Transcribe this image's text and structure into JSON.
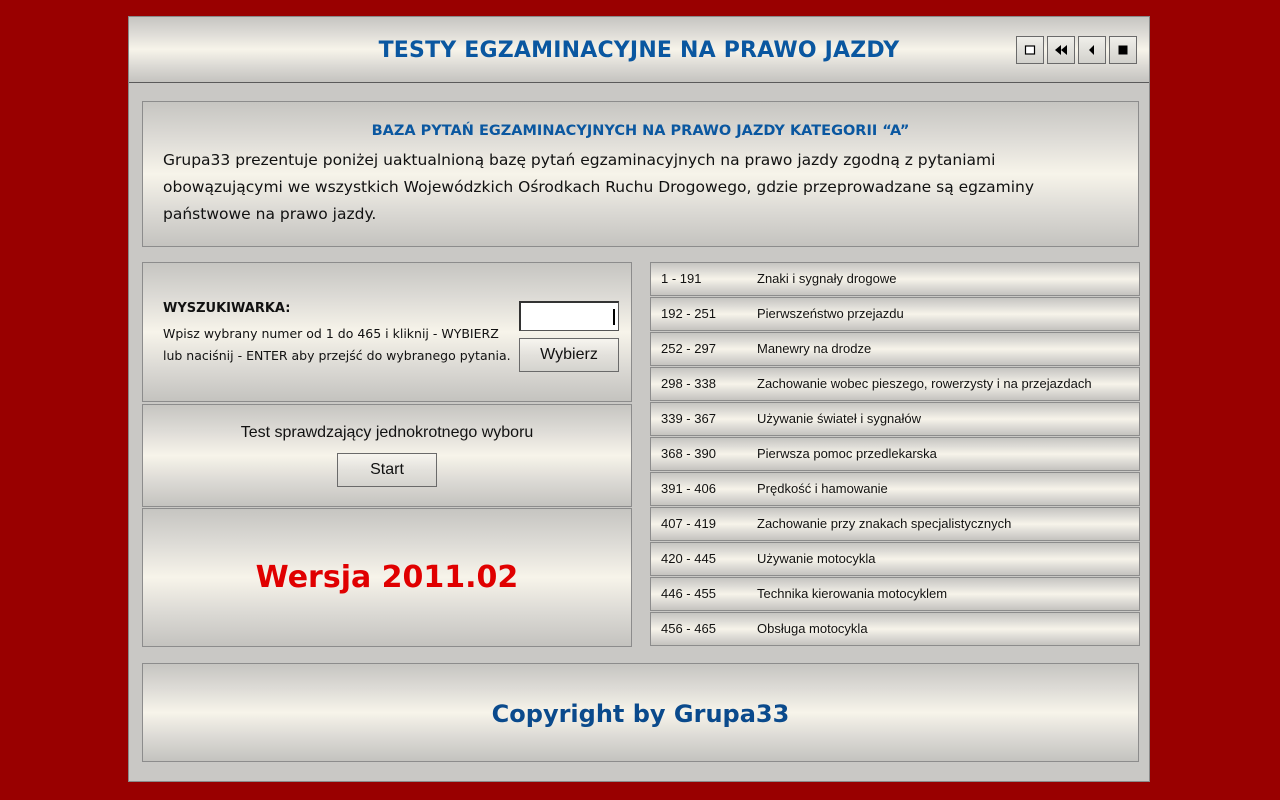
{
  "header": {
    "title": "TESTY EGZAMINACYJNE NA PRAWO JAZDY",
    "nav_buttons": [
      {
        "icon": "square-outline-icon"
      },
      {
        "icon": "rewind-icon"
      },
      {
        "icon": "back-icon"
      },
      {
        "icon": "stop-icon"
      }
    ]
  },
  "intro": {
    "title": "BAZA PYTAŃ EGZAMINACYJNYCH NA PRAWO JAZDY KATEGORII “A”",
    "text": "Grupa33 prezentuje poniżej uaktualnioną bazę pytań egzaminacyjnych na prawo jazdy zgodną z pytaniami obowązującymi we wszystkich Wojewódzkich Ośrodkach Ruchu Drogowego, gdzie przeprowadzane są egzaminy państwowe na prawo jazdy."
  },
  "search": {
    "label": "WYSZUKIWARKA:",
    "help_line1": "Wpisz wybrany numer od 1 do 465 i kliknij - WYBIERZ",
    "help_line2": "lub naciśnij - ENTER aby przejść do wybranego pytania.",
    "input_value": "",
    "button_label": "Wybierz"
  },
  "test": {
    "label": "Test sprawdzający jednokrotnego wyboru",
    "button_label": "Start"
  },
  "version": {
    "text": "Wersja 2011.02"
  },
  "categories": [
    {
      "range": "1 - 191",
      "name": "Znaki i sygnały drogowe"
    },
    {
      "range": "192 - 251",
      "name": "Pierwszeństwo przejazdu"
    },
    {
      "range": "252 - 297",
      "name": "Manewry na drodze"
    },
    {
      "range": "298 - 338",
      "name": "Zachowanie wobec pieszego, rowerzysty i na przejazdach"
    },
    {
      "range": "339 - 367",
      "name": "Używanie świateł i sygnałów"
    },
    {
      "range": "368 - 390",
      "name": "Pierwsza pomoc przedlekarska"
    },
    {
      "range": "391 - 406",
      "name": "Prędkość i hamowanie"
    },
    {
      "range": "407 - 419",
      "name": "Zachowanie przy znakach specjalistycznych"
    },
    {
      "range": "420 - 445",
      "name": "Używanie motocykla"
    },
    {
      "range": "446 - 455",
      "name": "Technika kierowania motocyklem"
    },
    {
      "range": "456 - 465",
      "name": "Obsługa motocykla"
    }
  ],
  "footer": {
    "text": "Copyright by Grupa33"
  },
  "colors": {
    "background": "#990000",
    "title_blue": "#0a57a0",
    "version_red": "#e00000",
    "footer_blue": "#0a4a8c"
  }
}
